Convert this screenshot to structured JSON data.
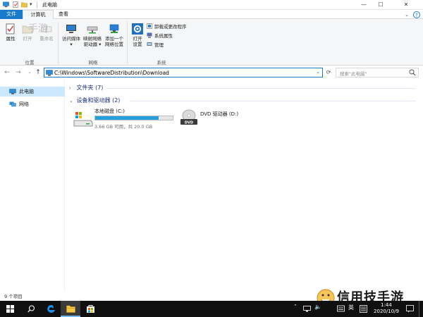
{
  "window": {
    "title": "此电脑",
    "controls": {
      "minimize": "—",
      "maximize": "☐",
      "close": "✕"
    }
  },
  "ribbon_tabs": {
    "file": "文件",
    "computer": "计算机",
    "view": "查看",
    "expand": "⌄",
    "help": "?"
  },
  "ribbon": {
    "location_group": {
      "label": "位置",
      "properties": "属性",
      "open": "打开",
      "rename": "重命名"
    },
    "network_group": {
      "label": "网络",
      "access_media_line1": "访问媒体",
      "map_drive_line1": "映射网络",
      "map_drive_line2": "驱动器",
      "add_location_line1": "添加一个",
      "add_location_line2": "网络位置"
    },
    "system_group": {
      "label": "系统",
      "open_settings_line1": "打开",
      "open_settings_line2": "设置",
      "uninstall": "卸载或更改程序",
      "system_properties": "系统属性",
      "manage": "管理"
    }
  },
  "address_bar": {
    "path": "C:\\Windows\\SoftwareDistribution\\Download",
    "search_placeholder": "搜索\"此电脑\""
  },
  "nav_pane": {
    "items": [
      {
        "label": "此电脑"
      },
      {
        "label": "网络"
      }
    ]
  },
  "content": {
    "folders_section": "文件夹 (7)",
    "devices_section": "设备和驱动器 (2)",
    "drives": [
      {
        "name": "本地磁盘 (C:)",
        "info": "3.66 GB 可用，共 20.0 GB",
        "used_fraction": 0.82
      },
      {
        "name": "DVD 驱动器 (D:)",
        "disc_label": "DVD"
      }
    ]
  },
  "status_bar": {
    "item_count": "9 个项目"
  },
  "taskbar": {
    "ime_label": "英",
    "time": "1:44",
    "date": "2020/10/9"
  },
  "watermark": {
    "text": "信用技手游",
    "top_text": "手游"
  },
  "colors": {
    "accent": "#1979ca",
    "selection": "#cce8ff",
    "drive_fill": "#26a0da",
    "section_title": "#1e3287",
    "taskbar": "#101010"
  }
}
